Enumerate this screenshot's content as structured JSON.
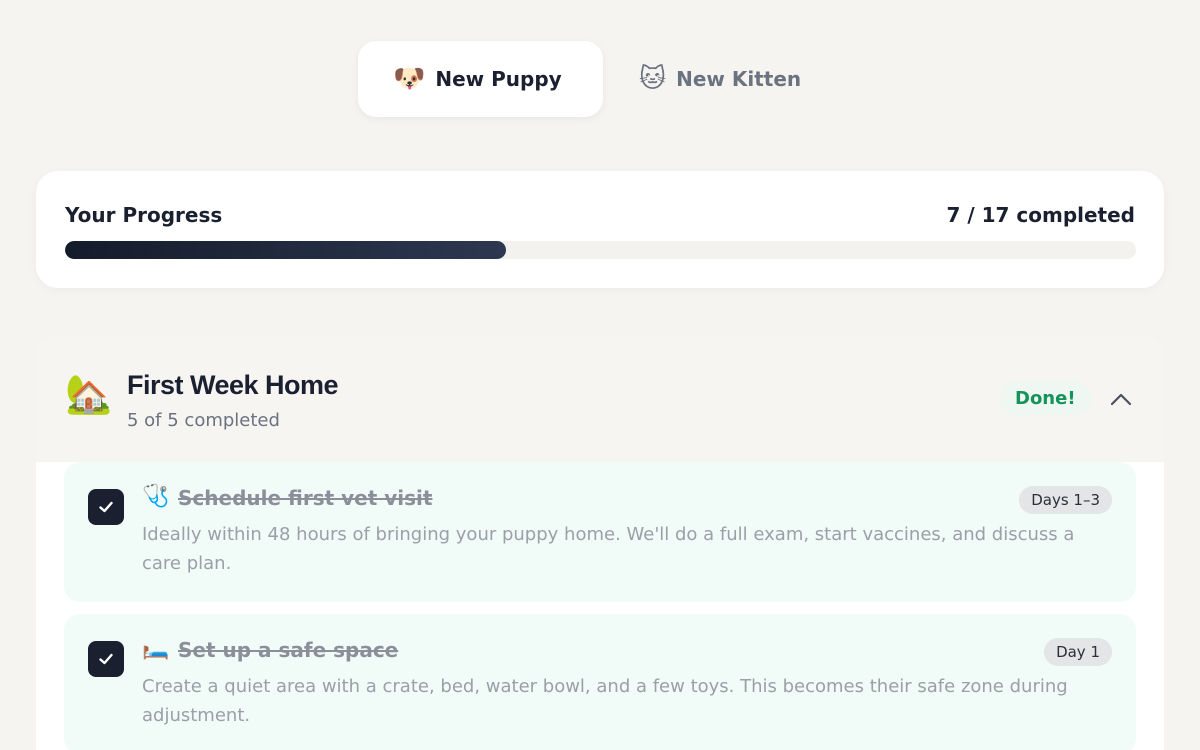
{
  "tabs": [
    {
      "emoji": "🐶",
      "label": "New Puppy",
      "active": true
    },
    {
      "emoji": "🐱",
      "label": "New Kitten",
      "active": false
    }
  ],
  "progress": {
    "title": "Your Progress",
    "count_text": "7 / 17 completed",
    "completed": 7,
    "total": 17
  },
  "section": {
    "emoji": "🏡",
    "title": "First Week Home",
    "subtitle": "5 of 5 completed",
    "badge": "Done!",
    "expanded": true,
    "tasks": [
      {
        "emoji": "🩺",
        "title": "Schedule first vet visit",
        "description": "Ideally within 48 hours of bringing your puppy home. We'll do a full exam, start vaccines, and discuss a care plan.",
        "timing": "Days 1–3",
        "checked": true
      },
      {
        "emoji": "🛏️",
        "title": "Set up a safe space",
        "description": "Create a quiet area with a crate, bed, water bowl, and a few toys. This becomes their safe zone during adjustment.",
        "timing": "Day 1",
        "checked": true
      }
    ]
  },
  "colors": {
    "background": "#f6f4f1",
    "accent_dark": "#1a2030",
    "done_green": "#15935a",
    "task_bg": "#f1fbf7"
  },
  "icons": {
    "checkbox": "check-icon",
    "collapse": "chevron-up-icon"
  }
}
